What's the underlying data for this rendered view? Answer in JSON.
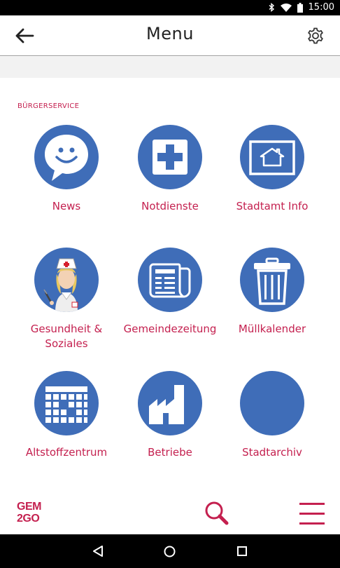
{
  "status": {
    "time": "15:00",
    "icons": [
      "bluetooth-icon",
      "wifi-icon",
      "battery-icon"
    ]
  },
  "header": {
    "title": "Menu",
    "back_icon": "arrow-left-icon",
    "settings_icon": "gear-icon"
  },
  "section": {
    "label": "BÜRGERSERVICE"
  },
  "tiles": [
    {
      "label": "News",
      "icon": "speech-bubble-smiley-icon"
    },
    {
      "label": "Notdienste",
      "icon": "medical-cross-icon"
    },
    {
      "label": "Stadtamt Info",
      "icon": "house-sign-icon"
    },
    {
      "label": "Gesundheit & Soziales",
      "icon": "nurse-icon"
    },
    {
      "label": "Gemeindezeitung",
      "icon": "newspaper-icon"
    },
    {
      "label": "Müllkalender",
      "icon": "trash-bin-icon"
    },
    {
      "label": "Altstoffzentrum",
      "icon": "calendar-grid-icon"
    },
    {
      "label": "Betriebe",
      "icon": "factory-icon"
    },
    {
      "label": "Stadtarchiv",
      "icon": "blank-circle-icon"
    }
  ],
  "bottom": {
    "logo_line1": "GEM",
    "logo_line2": "2GO",
    "search_icon": "search-icon",
    "menu_icon": "hamburger-icon"
  },
  "navbar": {
    "icons": [
      "back-triangle-icon",
      "home-circle-icon",
      "recents-square-icon"
    ]
  },
  "colors": {
    "accent": "#c4204f",
    "tile": "#3f6db8"
  }
}
